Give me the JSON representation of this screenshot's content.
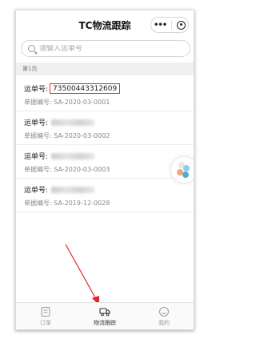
{
  "app": {
    "title": "TC物流跟踪",
    "capsule_more": "•••"
  },
  "search": {
    "placeholder": "请输入运单号"
  },
  "page_label": "第1页",
  "labels": {
    "tracking": "运单号:",
    "doc": "单据编号:"
  },
  "shipments": [
    {
      "tracking_number": "73500443312609",
      "doc_number": "SA-2020-03-0001",
      "highlighted": true
    },
    {
      "tracking_number": "",
      "doc_number": "SA-2020-03-0002",
      "highlighted": false
    },
    {
      "tracking_number": "",
      "doc_number": "SA-2020-03-0003",
      "highlighted": false
    },
    {
      "tracking_number": "",
      "doc_number": "SA-2019-12-0028",
      "highlighted": false
    }
  ],
  "tabs": [
    {
      "label": "订单",
      "icon": "order-icon",
      "active": false
    },
    {
      "label": "物流跟踪",
      "icon": "truck-icon",
      "active": true
    },
    {
      "label": "我的",
      "icon": "profile-icon",
      "active": false
    }
  ],
  "colors": {
    "highlight": "#e0262a",
    "arrow": "#e0262a"
  }
}
